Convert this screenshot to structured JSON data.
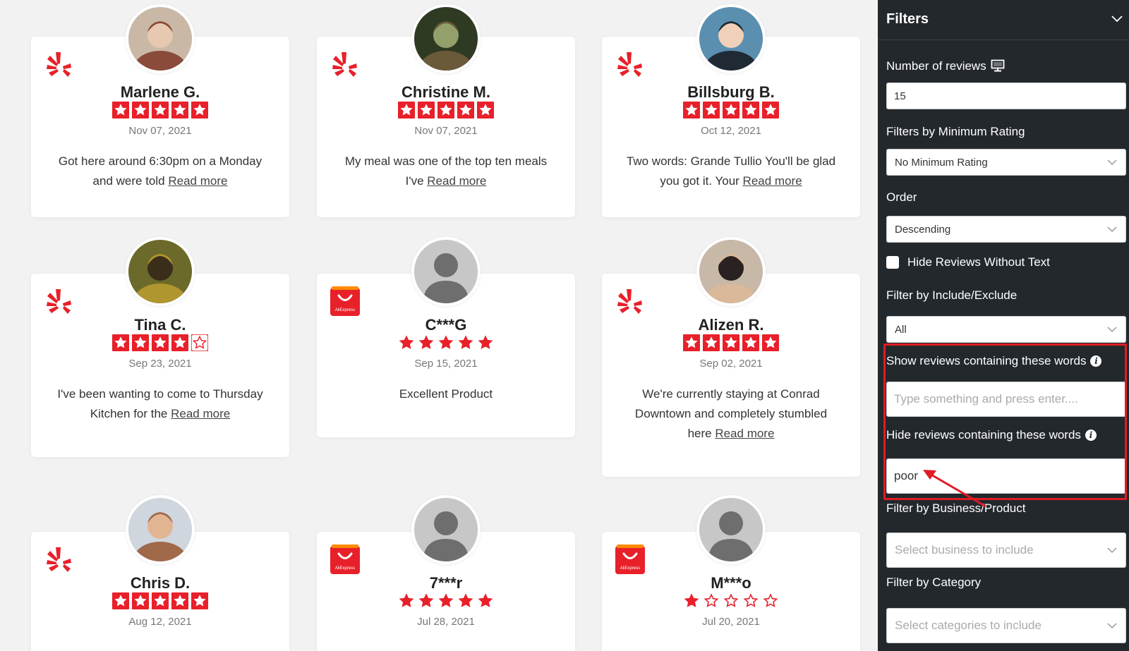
{
  "reviews": [
    {
      "name": "Marlene G.",
      "date": "Nov 07, 2021",
      "text": "Got here around 6:30pm on a Monday and were told",
      "read_more": "Read more",
      "rating": 5,
      "platform": "yelp-logo",
      "avatar": "photo"
    },
    {
      "name": "Christine M.",
      "date": "Nov 07, 2021",
      "text": "My meal was one of the top ten meals I've",
      "read_more": "Read more",
      "rating": 5,
      "platform": "yelp-logo",
      "avatar": "photo"
    },
    {
      "name": "Billsburg B.",
      "date": "Oct 12, 2021",
      "text": "Two words: Grande Tullio You'll be glad you got it. Your",
      "read_more": "Read more",
      "rating": 5,
      "platform": "yelp-logo",
      "avatar": "photo"
    },
    {
      "name": "Tina C.",
      "date": "Sep 23, 2021",
      "text": "I've been wanting to come to Thursday Kitchen for the",
      "read_more": "Read more",
      "rating": 4,
      "platform": "yelp-logo",
      "avatar": "photo"
    },
    {
      "name": "C***G",
      "date": "Sep 15, 2021",
      "text": "Excellent Product",
      "read_more": "",
      "rating": 5,
      "platform": "aliexpress-logo",
      "avatar": "placeholder"
    },
    {
      "name": "Alizen R.",
      "date": "Sep 02, 2021",
      "text": "We're currently staying at Conrad Downtown and completely stumbled here",
      "read_more": "Read more",
      "rating": 5,
      "platform": "yelp-logo",
      "avatar": "photo"
    },
    {
      "name": "Chris D.",
      "date": "Aug 12, 2021",
      "text": "",
      "read_more": "",
      "rating": 5,
      "platform": "yelp-logo",
      "avatar": "photo"
    },
    {
      "name": "7***r",
      "date": "Jul 28, 2021",
      "text": "",
      "read_more": "",
      "rating": 5,
      "platform": "aliexpress-logo",
      "avatar": "placeholder"
    },
    {
      "name": "M***o",
      "date": "Jul 20, 2021",
      "text": "",
      "read_more": "",
      "rating": 1,
      "platform": "aliexpress-logo",
      "avatar": "placeholder"
    }
  ],
  "aliexpress_logo_text": "AliExpress",
  "colors": {
    "accent": "#e8202a",
    "sidebar_bg": "#23282d",
    "highlight": "#e01b24"
  },
  "filters": {
    "title": "Filters",
    "collapse_icon": "chevron-down-icon",
    "number_of_reviews": {
      "label": "Number of reviews",
      "value": "15",
      "icon": "monitor-icon"
    },
    "min_rating": {
      "label": "Filters by Minimum Rating",
      "value": "No Minimum Rating"
    },
    "order": {
      "label": "Order",
      "value": "Descending"
    },
    "hide_without_text": {
      "label": "Hide Reviews Without Text",
      "checked": false
    },
    "include_exclude": {
      "label": "Filter by Include/Exclude",
      "value": "All"
    },
    "show_words": {
      "label": "Show reviews containing these words",
      "value": "",
      "placeholder": "Type something and press enter...."
    },
    "hide_words": {
      "label": "Hide reviews containing these words",
      "value": "poor",
      "placeholder": ""
    },
    "business": {
      "label": "Filter by Business/Product",
      "placeholder": "Select business to include"
    },
    "category": {
      "label": "Filter by Category",
      "placeholder": "Select categories to include"
    }
  }
}
